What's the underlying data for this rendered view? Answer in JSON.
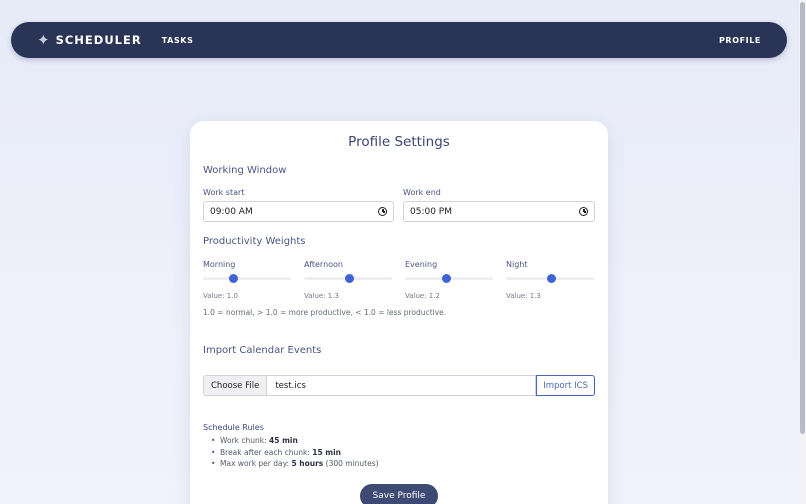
{
  "nav": {
    "brand_icon": "sparkle-icon",
    "brand": "Scheduler",
    "tasks_label": "Tasks",
    "profile_label": "Profile"
  },
  "card": {
    "title": "Profile Settings",
    "working_window": {
      "heading": "Working Window",
      "start_label": "Work start",
      "start_value": "09:00 AM",
      "end_label": "Work end",
      "end_value": "05:00 PM"
    },
    "productivity": {
      "heading": "Productivity Weights",
      "sliders": [
        {
          "label": "Morning",
          "value_text": "Value: 1.0",
          "position": 0.35
        },
        {
          "label": "Afternoon",
          "value_text": "Value: 1.3",
          "position": 0.52
        },
        {
          "label": "Evening",
          "value_text": "Value: 1.2",
          "position": 0.47
        },
        {
          "label": "Night",
          "value_text": "Value: 1.3",
          "position": 0.52
        }
      ],
      "hint": "1.0 = normal, > 1.0 = more productive, < 1.0 = less productive."
    },
    "import": {
      "heading": "Import Calendar Events",
      "choose_label": "Choose File",
      "file_name": "test.ics",
      "import_label": "Import ICS"
    },
    "rules": {
      "title": "Schedule Rules",
      "items": [
        {
          "prefix": "Work chunk: ",
          "bold": "45 min",
          "suffix": ""
        },
        {
          "prefix": "Break after each chunk: ",
          "bold": "15 min",
          "suffix": ""
        },
        {
          "prefix": "Max work per day: ",
          "bold": "5 hours",
          "suffix": " (300 minutes)"
        }
      ]
    },
    "save_label": "Save Profile"
  },
  "colors": {
    "navbar": "#2a3457",
    "accent": "#3e63d6",
    "save_button": "#3d4a73"
  }
}
